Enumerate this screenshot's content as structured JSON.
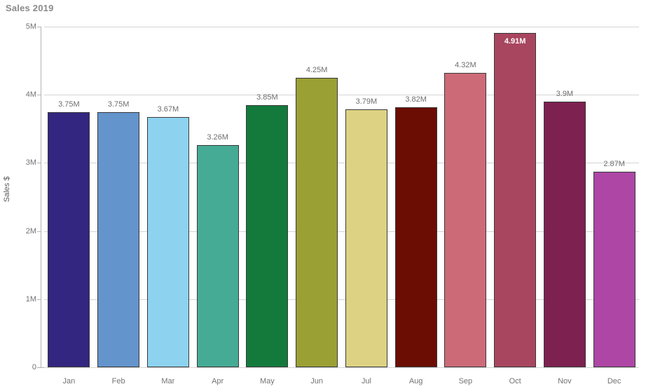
{
  "chart": {
    "title": "Sales 2019",
    "y_axis_title": "Sales $"
  },
  "chart_data": {
    "type": "bar",
    "title": "Sales 2019",
    "xlabel": "",
    "ylabel": "Sales $",
    "ylim": [
      0,
      5000000
    ],
    "ytick_labels": [
      "0",
      "1M",
      "2M",
      "3M",
      "4M",
      "5M"
    ],
    "ytick_values": [
      0,
      1000000,
      2000000,
      3000000,
      4000000,
      5000000
    ],
    "grid": true,
    "legend": "none",
    "value_format": "M",
    "categories": [
      "Jan",
      "Feb",
      "Mar",
      "Apr",
      "May",
      "Jun",
      "Jul",
      "Aug",
      "Sep",
      "Oct",
      "Nov",
      "Dec"
    ],
    "values": [
      3750000,
      3750000,
      3670000,
      3260000,
      3850000,
      4250000,
      3790000,
      3820000,
      4320000,
      4910000,
      3900000,
      2870000
    ],
    "data_labels": [
      "3.75M",
      "3.75M",
      "3.67M",
      "3.26M",
      "3.85M",
      "4.25M",
      "3.79M",
      "3.82M",
      "4.32M",
      "4.91M",
      "3.9M",
      "2.87M"
    ],
    "label_placement": [
      "above",
      "above",
      "above",
      "above",
      "above",
      "above",
      "above",
      "above",
      "above",
      "inside",
      "above",
      "above"
    ],
    "colors": [
      "#332680",
      "#6394cc",
      "#8dd3ef",
      "#45ab95",
      "#137a3c",
      "#9aa034",
      "#ddd283",
      "#6b0d03",
      "#cd6a78",
      "#a9465f",
      "#7d2150",
      "#ad46a5"
    ],
    "bar_border_color": "#3a3a3a",
    "gridline_color": "#d4d4d4",
    "axis_color": "#b3b3b3",
    "title_color": "#8a8a8a",
    "tick_label_color": "#737373",
    "data_label_color": "#6e6e6e",
    "inside_label_color": "#ffffff",
    "background": "#ffffff"
  }
}
